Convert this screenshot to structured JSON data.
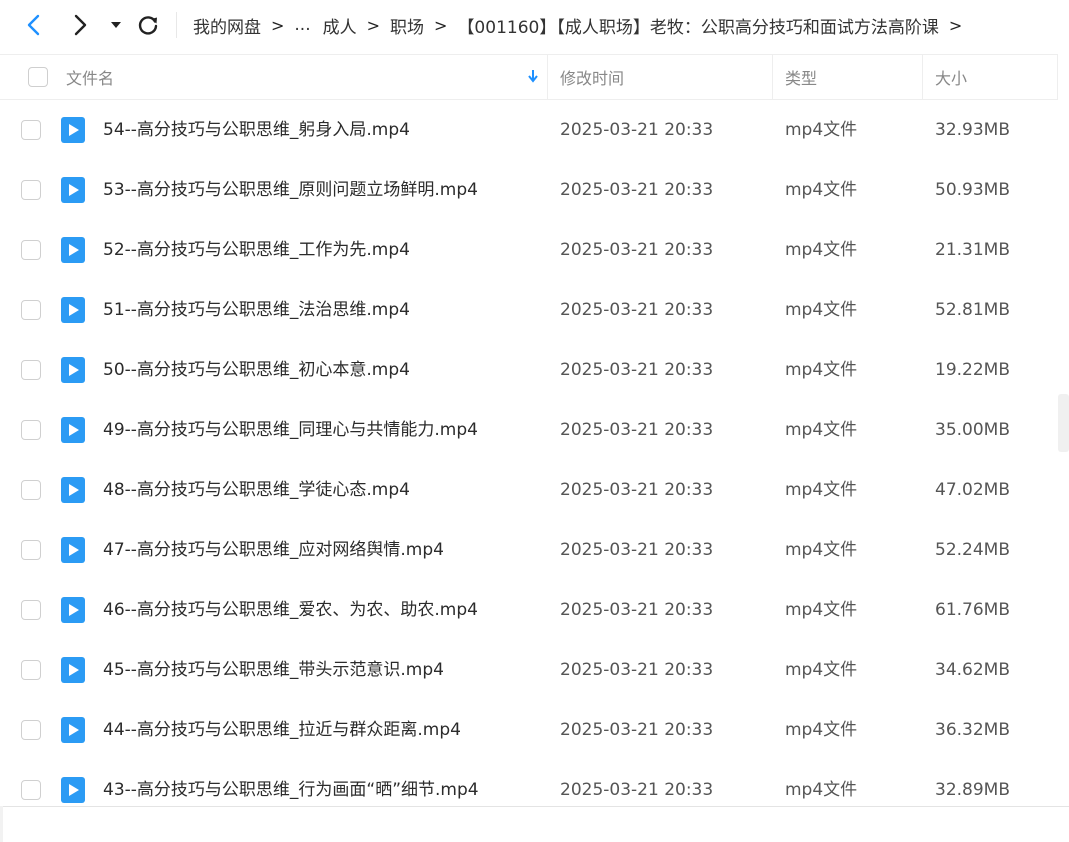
{
  "breadcrumb": {
    "items": [
      "我的网盘",
      "...",
      "成人",
      "职场",
      "【001160】【成人职场】老牧：公职高分技巧和面试方法高阶课"
    ],
    "separator": ">"
  },
  "toolbar": {
    "back_icon": "chevron-left-icon",
    "forward_icon": "chevron-right-icon",
    "history_icon": "caret-down-icon",
    "refresh_icon": "refresh-icon"
  },
  "columns": {
    "name": "文件名",
    "modified": "修改时间",
    "type": "类型",
    "size": "大小",
    "sort_icon": "sort-down-arrow-icon"
  },
  "colors": {
    "accent": "#1e90ff",
    "file_icon": "#2b9bf4",
    "header_text": "#888888"
  },
  "files": [
    {
      "name": "54--高分技巧与公职思维_躬身入局.mp4",
      "modified": "2025-03-21 20:33",
      "type": "mp4文件",
      "size": "32.93MB"
    },
    {
      "name": "53--高分技巧与公职思维_原则问题立场鲜明.mp4",
      "modified": "2025-03-21 20:33",
      "type": "mp4文件",
      "size": "50.93MB"
    },
    {
      "name": "52--高分技巧与公职思维_工作为先.mp4",
      "modified": "2025-03-21 20:33",
      "type": "mp4文件",
      "size": "21.31MB"
    },
    {
      "name": "51--高分技巧与公职思维_法治思维.mp4",
      "modified": "2025-03-21 20:33",
      "type": "mp4文件",
      "size": "52.81MB"
    },
    {
      "name": "50--高分技巧与公职思维_初心本意.mp4",
      "modified": "2025-03-21 20:33",
      "type": "mp4文件",
      "size": "19.22MB"
    },
    {
      "name": "49--高分技巧与公职思维_同理心与共情能力.mp4",
      "modified": "2025-03-21 20:33",
      "type": "mp4文件",
      "size": "35.00MB"
    },
    {
      "name": "48--高分技巧与公职思维_学徒心态.mp4",
      "modified": "2025-03-21 20:33",
      "type": "mp4文件",
      "size": "47.02MB"
    },
    {
      "name": "47--高分技巧与公职思维_应对网络舆情.mp4",
      "modified": "2025-03-21 20:33",
      "type": "mp4文件",
      "size": "52.24MB"
    },
    {
      "name": "46--高分技巧与公职思维_爱农、为农、助农.mp4",
      "modified": "2025-03-21 20:33",
      "type": "mp4文件",
      "size": "61.76MB"
    },
    {
      "name": "45--高分技巧与公职思维_带头示范意识.mp4",
      "modified": "2025-03-21 20:33",
      "type": "mp4文件",
      "size": "34.62MB"
    },
    {
      "name": "44--高分技巧与公职思维_拉近与群众距离.mp4",
      "modified": "2025-03-21 20:33",
      "type": "mp4文件",
      "size": "36.32MB"
    },
    {
      "name": "43--高分技巧与公职思维_行为画面“晒”细节.mp4",
      "modified": "2025-03-21 20:33",
      "type": "mp4文件",
      "size": "32.89MB"
    }
  ]
}
